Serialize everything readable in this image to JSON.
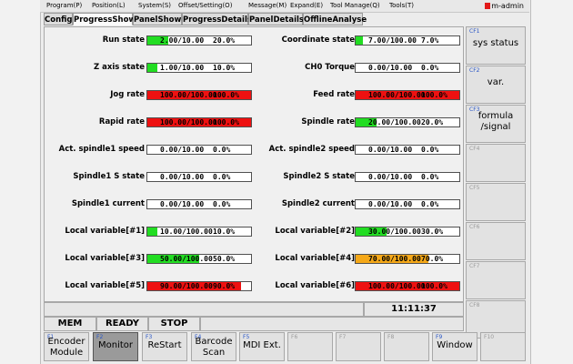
{
  "menu": [
    "Program(P)",
    "Position(L)",
    "System(S)",
    "Offset/Setting(O)",
    "Message(M)",
    "Expand(E)",
    "Tool Manage(Q)",
    "Tools(T)"
  ],
  "user": "m-admin",
  "tabs": [
    "Config",
    "ProgressShow",
    "PanelShow",
    "ProgressDetails",
    "PanelDetails",
    "OfflineAnalyse"
  ],
  "active_tab": "ProgressShow",
  "colors": {
    "green": "#22dd22",
    "red": "#ee1111",
    "orange": "#f5a818",
    "empty": "#ffffff"
  },
  "left": [
    {
      "label": "Run state",
      "value": "2.00/10.00",
      "percent": "20.0%",
      "fill": 0.2,
      "color": "green"
    },
    {
      "label": "Z axis state",
      "value": "1.00/10.00",
      "percent": "10.0%",
      "fill": 0.1,
      "color": "green"
    },
    {
      "label": "Jog rate",
      "value": "100.00/100.00",
      "percent": "100.0%",
      "fill": 1.0,
      "color": "red"
    },
    {
      "label": "Rapid rate",
      "value": "100.00/100.00",
      "percent": "100.0%",
      "fill": 1.0,
      "color": "red"
    },
    {
      "label": "Act. spindle1 speed",
      "value": "0.00/10.00",
      "percent": "0.0%",
      "fill": 0,
      "color": "green"
    },
    {
      "label": "Spindle1 S state",
      "value": "0.00/10.00",
      "percent": "0.0%",
      "fill": 0,
      "color": "green"
    },
    {
      "label": "Spindle1 current",
      "value": "0.00/10.00",
      "percent": "0.0%",
      "fill": 0,
      "color": "green"
    },
    {
      "label": "Local variable[#1]",
      "value": "10.00/100.00",
      "percent": "10.0%",
      "fill": 0.1,
      "color": "green"
    },
    {
      "label": "Local variable[#3]",
      "value": "50.00/100.00",
      "percent": "50.0%",
      "fill": 0.5,
      "color": "green"
    },
    {
      "label": "Local variable[#5]",
      "value": "90.00/100.00",
      "percent": "90.0%",
      "fill": 0.9,
      "color": "red"
    }
  ],
  "right": [
    {
      "label": "Coordinate state",
      "value": "7.00/100.00",
      "percent": "7.0%",
      "fill": 0.07,
      "color": "green"
    },
    {
      "label": "CH0 Torque",
      "value": "0.00/10.00",
      "percent": "0.0%",
      "fill": 0,
      "color": "green"
    },
    {
      "label": "Feed rate",
      "value": "100.00/100.00",
      "percent": "100.0%",
      "fill": 1.0,
      "color": "red"
    },
    {
      "label": "Spindle rate",
      "value": "20.00/100.00",
      "percent": "20.0%",
      "fill": 0.2,
      "color": "green"
    },
    {
      "label": "Act. spindle2 speed",
      "value": "0.00/10.00",
      "percent": "0.0%",
      "fill": 0,
      "color": "green"
    },
    {
      "label": "Spindle2 S state",
      "value": "0.00/10.00",
      "percent": "0.0%",
      "fill": 0,
      "color": "green"
    },
    {
      "label": "Spindle2 current",
      "value": "0.00/10.00",
      "percent": "0.0%",
      "fill": 0,
      "color": "green"
    },
    {
      "label": "Local variable[#2]",
      "value": "30.00/100.00",
      "percent": "30.0%",
      "fill": 0.3,
      "color": "green"
    },
    {
      "label": "Local variable[#4]",
      "value": "70.00/100.00",
      "percent": "70.0%",
      "fill": 0.7,
      "color": "orange"
    },
    {
      "label": "Local variable[#6]",
      "value": "100.00/100.00",
      "percent": "100.0%",
      "fill": 1.0,
      "color": "red"
    }
  ],
  "clock": "11:11:37",
  "status": {
    "mode": "MEM",
    "state": "READY",
    "motion": "STOP"
  },
  "cf_keys": [
    {
      "code": "CF1",
      "label": "sys status"
    },
    {
      "code": "CF2",
      "label": "var."
    },
    {
      "code": "CF3",
      "label": "formula\n/signal"
    },
    {
      "code": "CF4",
      "label": ""
    },
    {
      "code": "CF5",
      "label": ""
    },
    {
      "code": "CF6",
      "label": ""
    },
    {
      "code": "CF7",
      "label": ""
    },
    {
      "code": "CF8",
      "label": ""
    }
  ],
  "f_keys": [
    {
      "code": "F1",
      "label": "Encoder\nModule"
    },
    {
      "code": "F2",
      "label": "Monitor"
    },
    {
      "code": "F3",
      "label": "ReStart"
    },
    {
      "code": "F4",
      "label": "Barcode\nScan"
    },
    {
      "code": "F5",
      "label": "MDI Ext."
    },
    {
      "code": "F6",
      "label": ""
    },
    {
      "code": "F7",
      "label": ""
    },
    {
      "code": "F8",
      "label": ""
    },
    {
      "code": "F9",
      "label": "Window"
    },
    {
      "code": "F10",
      "label": ""
    }
  ],
  "active_f_key": "F2"
}
